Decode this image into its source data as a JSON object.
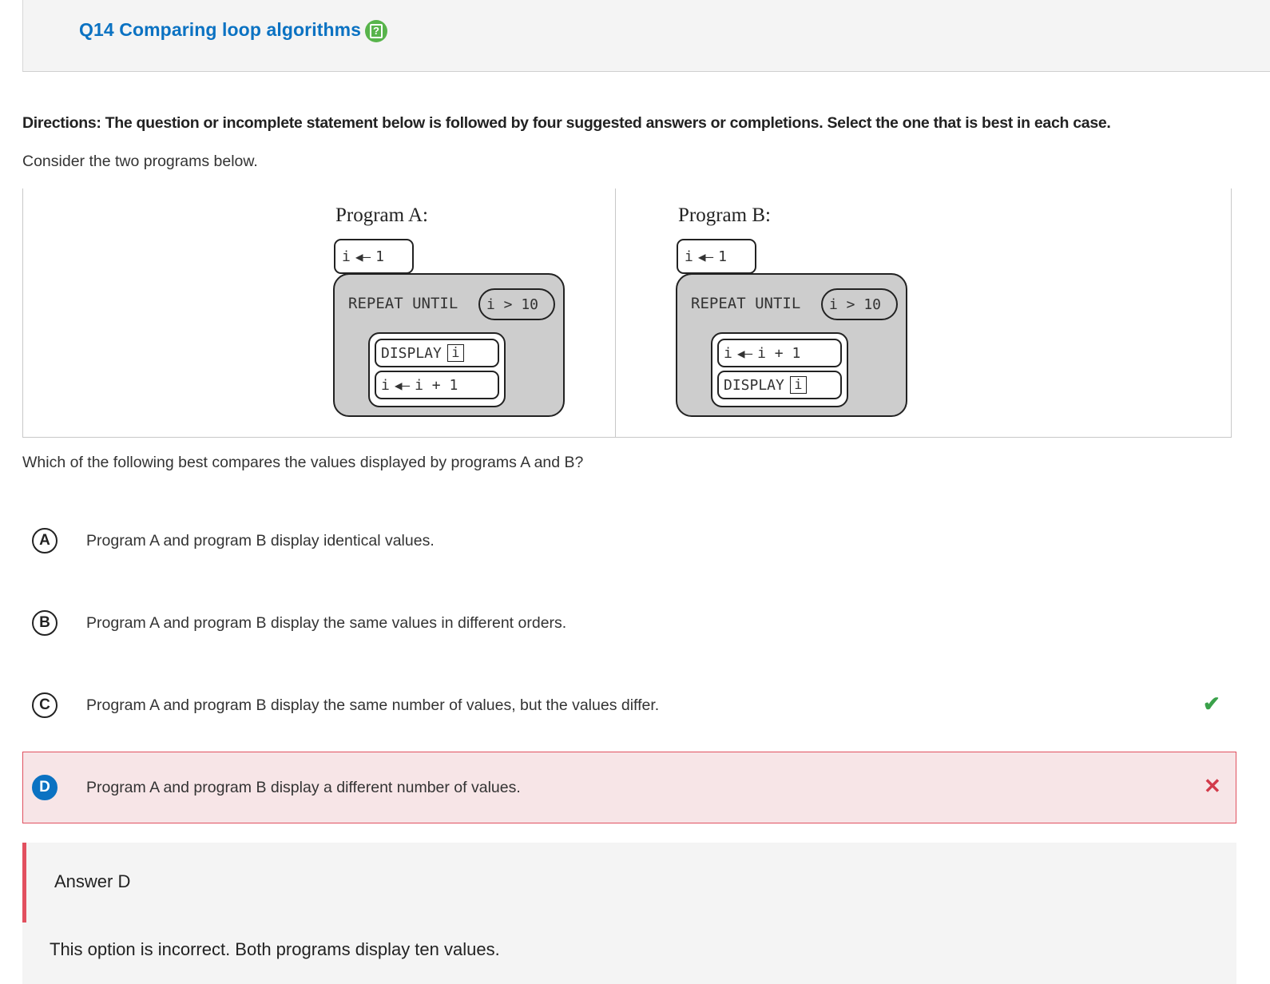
{
  "header": {
    "title": "Q14 Comparing loop algorithms",
    "help_icon": "question-mark-icon",
    "help_glyph": "?",
    "accent_color": "#0b72c2",
    "help_color": "#58b44b"
  },
  "directions": "Directions: The question or incomplete statement below is followed by four suggested answers or completions. Select the one that is best in each case.",
  "intro": "Consider the two programs below.",
  "programs": [
    {
      "title": "Program A:",
      "init": {
        "var": "i",
        "value": "1"
      },
      "loop": {
        "keyword": "REPEAT UNTIL",
        "condition": "i > 10"
      },
      "body": [
        {
          "type": "display",
          "keyword": "DISPLAY",
          "var": "i"
        },
        {
          "type": "assign",
          "var": "i",
          "expr": "i + 1"
        }
      ]
    },
    {
      "title": "Program B:",
      "init": {
        "var": "i",
        "value": "1"
      },
      "loop": {
        "keyword": "REPEAT UNTIL",
        "condition": "i > 10"
      },
      "body": [
        {
          "type": "assign",
          "var": "i",
          "expr": "i + 1"
        },
        {
          "type": "display",
          "keyword": "DISPLAY",
          "var": "i"
        }
      ]
    }
  ],
  "arrow_glyph": "◀—",
  "question": "Which of the following best compares the values displayed by programs A and B?",
  "choices": [
    {
      "letter": "A",
      "text": "Program A and program B display identical values.",
      "mark": ""
    },
    {
      "letter": "B",
      "text": "Program A and program B display the same values in different orders.",
      "mark": ""
    },
    {
      "letter": "C",
      "text": "Program A and program B display the same number of values, but the values differ.",
      "mark": "✔"
    },
    {
      "letter": "D",
      "text": "Program A and program B display a different number of values.",
      "mark": "✕"
    }
  ],
  "status_colors": {
    "correct": "#3aa14a",
    "incorrect": "#d23a4a",
    "selected_bg": "#f7e5e7"
  },
  "feedback": {
    "title": "Answer D",
    "explanation": "This option is incorrect. Both programs display ten values."
  }
}
